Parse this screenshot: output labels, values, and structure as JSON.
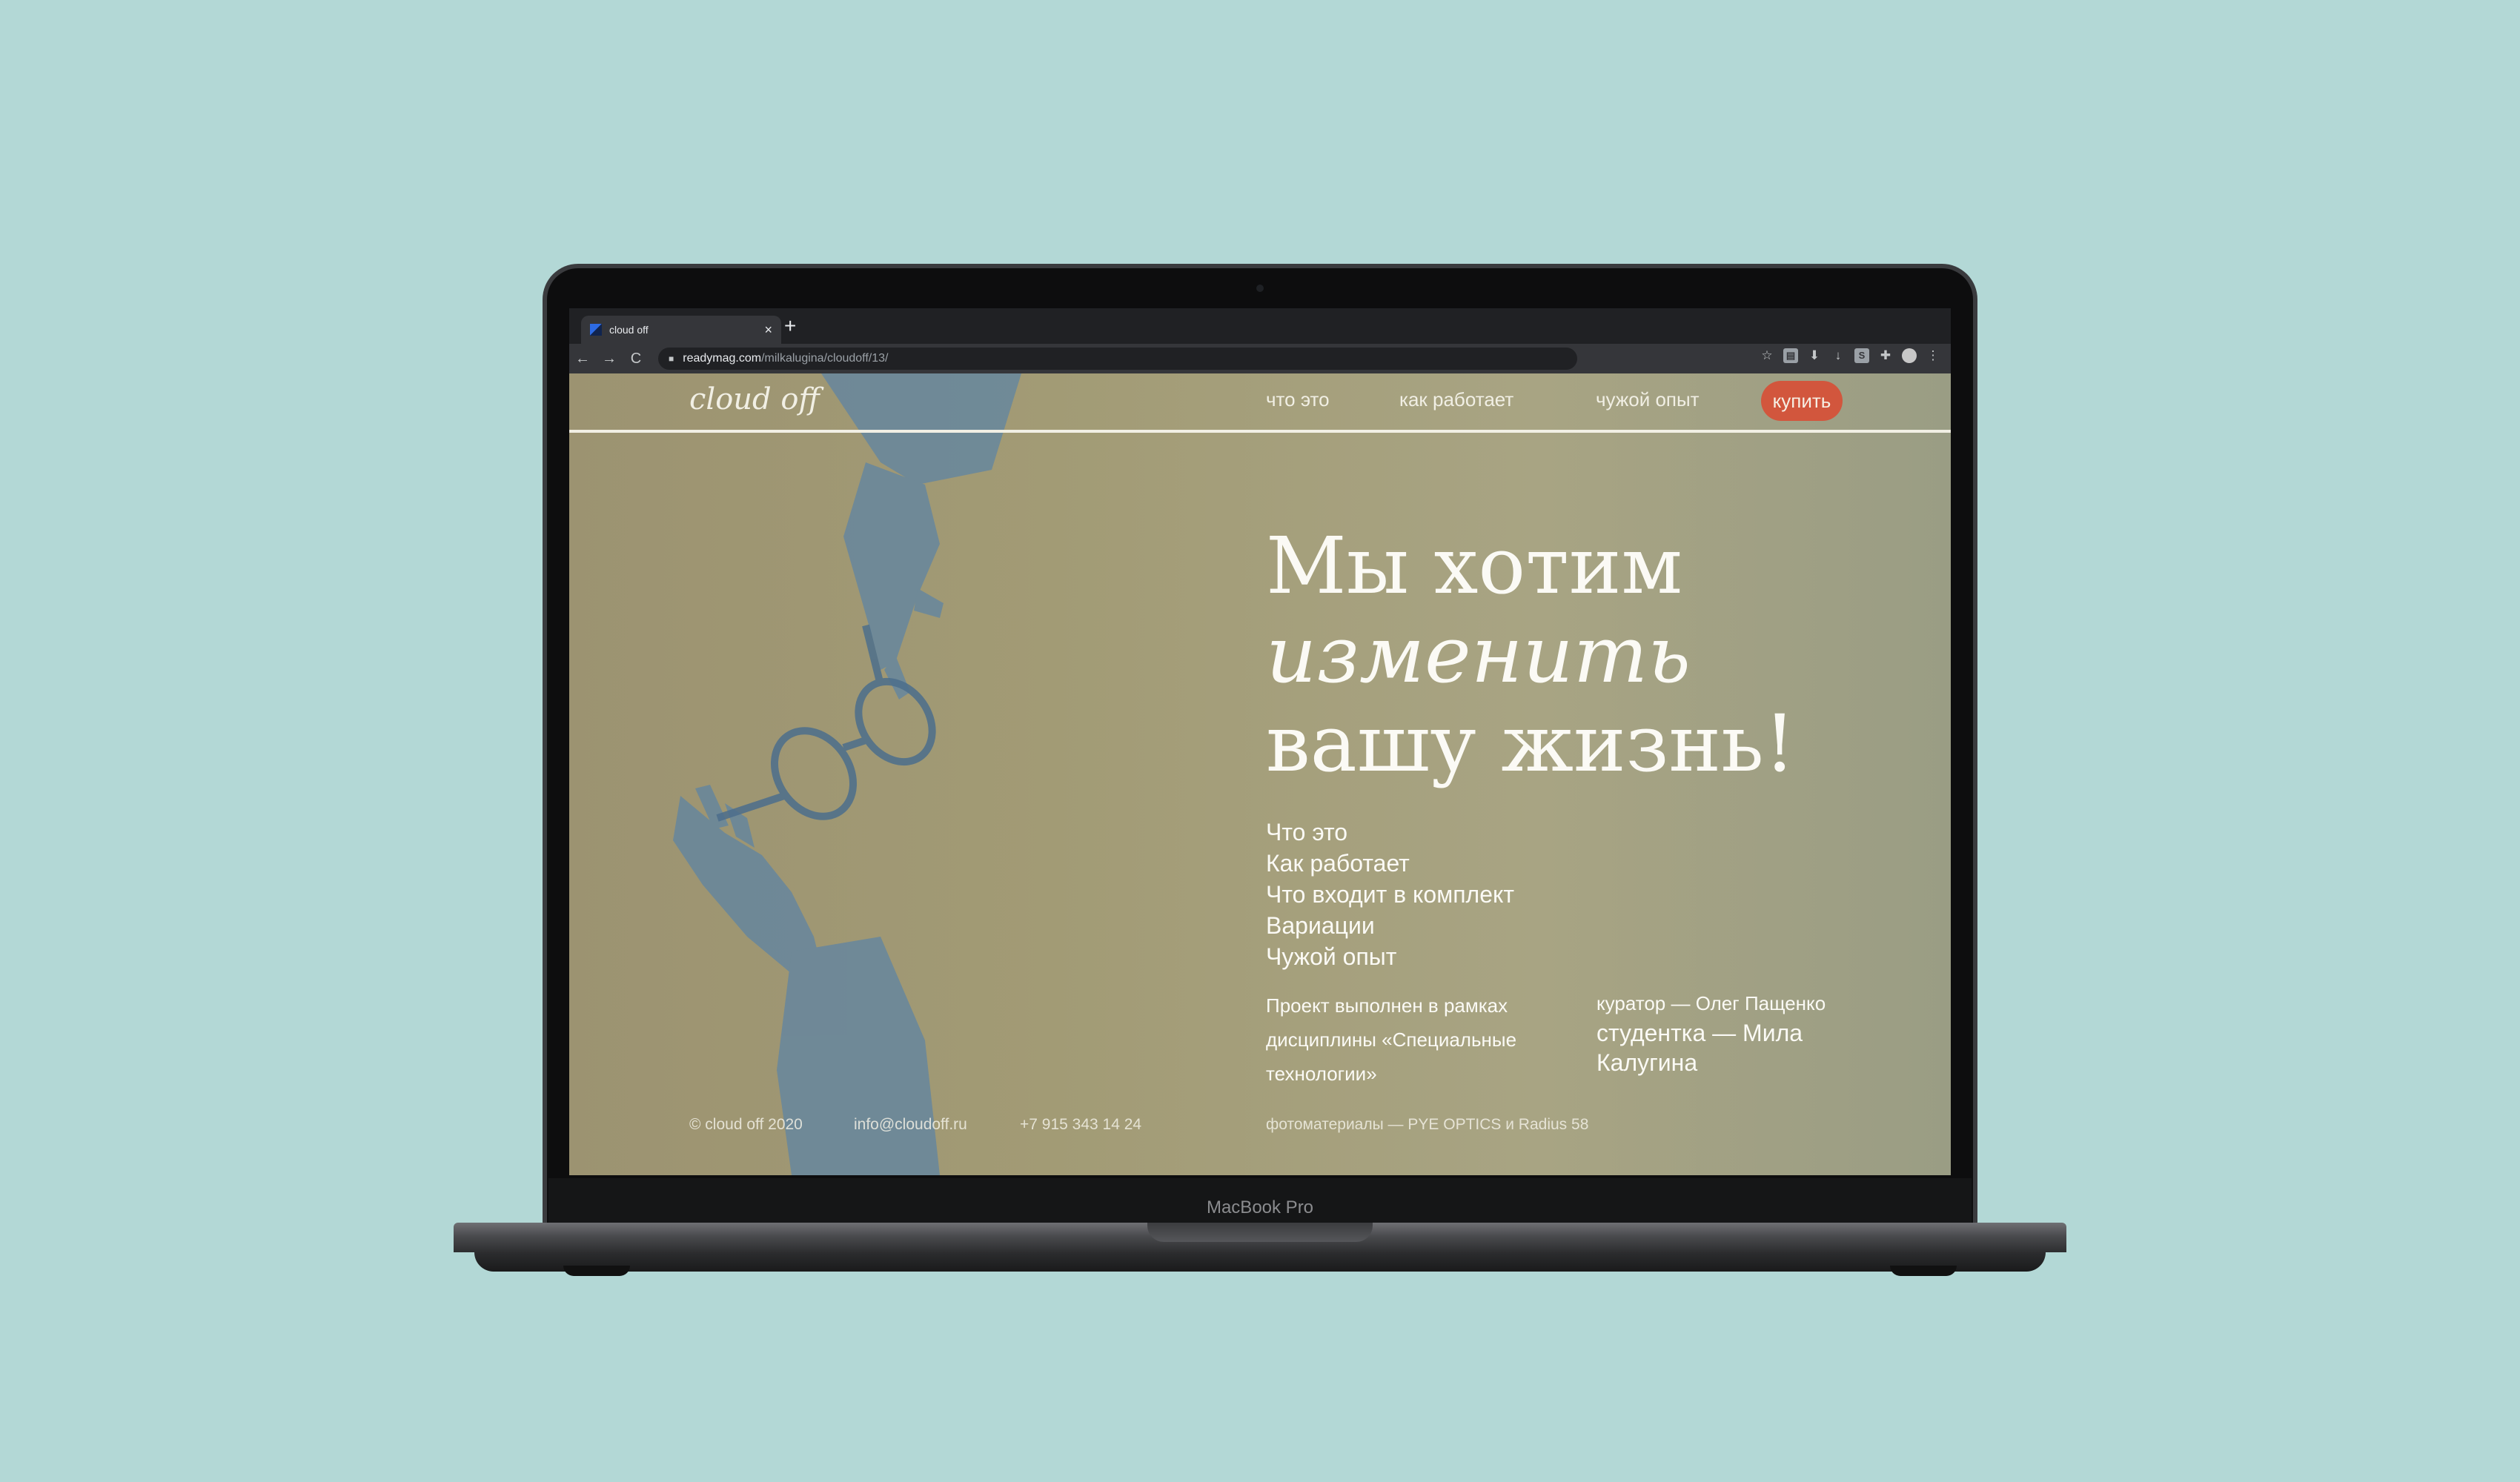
{
  "browser": {
    "tab_title": "cloud off",
    "tab_close": "×",
    "new_tab": "+",
    "back": "←",
    "forward": "→",
    "reload": "C",
    "url_host": "readymag.com",
    "url_path": "/milkalugina/cloudoff/13/",
    "extensions": [
      "star-icon",
      "bookmark-icon",
      "download-icon",
      "arrow-down-icon",
      "s-extension-icon",
      "puzzle-icon",
      "avatar-icon",
      "more-vert-icon"
    ]
  },
  "site": {
    "logo": "cloud off",
    "nav": [
      "что это",
      "как работает",
      "чужой опыт"
    ],
    "buy": "купить",
    "headline": {
      "line1": "Мы хотим",
      "line2": "изменить",
      "line3": "вашу жизнь!"
    },
    "menu": [
      "Что это",
      "Как работает",
      "Что входит в комплект",
      "Вариации",
      "Чужой опыт"
    ],
    "project": "Проект выполнен в рамках дисциплины «Специальные технологии»",
    "curator": "куратор — Олег Пащенко",
    "student": "студентка — Мила Калугина",
    "footer": {
      "copyright": "© cloud off 2020",
      "email": "info@cloudoff.ru",
      "phone": "+7 915 343 14 24",
      "photos": "фотоматериалы — PYE OPTICS и Radius 58"
    }
  },
  "device_label": "MacBook Pro",
  "colors": {
    "background": "#b3d8d6",
    "buy_button": "#d2563d",
    "page_tan": "#a29b75",
    "shadow_blue": "#5f84a3"
  }
}
